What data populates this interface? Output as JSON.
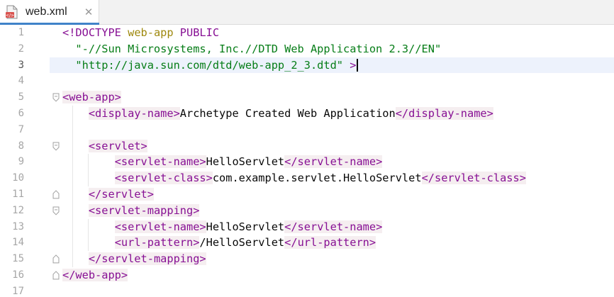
{
  "tab": {
    "label": "web.xml",
    "close_glyph": "✕",
    "icon": "xml-file-icon"
  },
  "line_numbers": [
    "1",
    "2",
    "3",
    "4",
    "5",
    "6",
    "7",
    "8",
    "9",
    "10",
    "11",
    "12",
    "13",
    "14",
    "15",
    "16",
    "17"
  ],
  "current_line": 3,
  "code": {
    "l1": {
      "doctype_open": "<!DOCTYPE",
      "root": "web-app",
      "public": "PUBLIC"
    },
    "l2": {
      "public_id": "\"-//Sun Microsystems, Inc.//DTD Web Application 2.3//EN\""
    },
    "l3": {
      "system_id": "\"http://java.sun.com/dtd/web-app_2_3.dtd\"",
      "close": ">"
    },
    "l5": {
      "tag": "<web-app>"
    },
    "l6": {
      "open": "<display-name>",
      "text": "Archetype Created Web Application",
      "close": "</display-name>"
    },
    "l8": {
      "tag": "<servlet>"
    },
    "l9": {
      "open": "<servlet-name>",
      "text": "HelloServlet",
      "close": "</servlet-name>"
    },
    "l10": {
      "open": "<servlet-class>",
      "text": "com.example.servlet.HelloServlet",
      "close": "</servlet-class>"
    },
    "l11": {
      "tag": "</servlet>"
    },
    "l12": {
      "tag": "<servlet-mapping>"
    },
    "l13": {
      "open": "<servlet-name>",
      "text": "HelloServlet",
      "close": "</servlet-name>"
    },
    "l14": {
      "open": "<url-pattern>",
      "text": "/HelloServlet",
      "close": "</url-pattern>"
    },
    "l15": {
      "tag": "</servlet-mapping>"
    },
    "l16": {
      "tag": "</web-app>"
    }
  },
  "colors": {
    "tag": "#871094",
    "string": "#067d17",
    "tag_background": "#f5eef0",
    "current_line": "#edf2fc",
    "line_number": "#a6a6a6",
    "tab_accent": "#4083c9"
  }
}
